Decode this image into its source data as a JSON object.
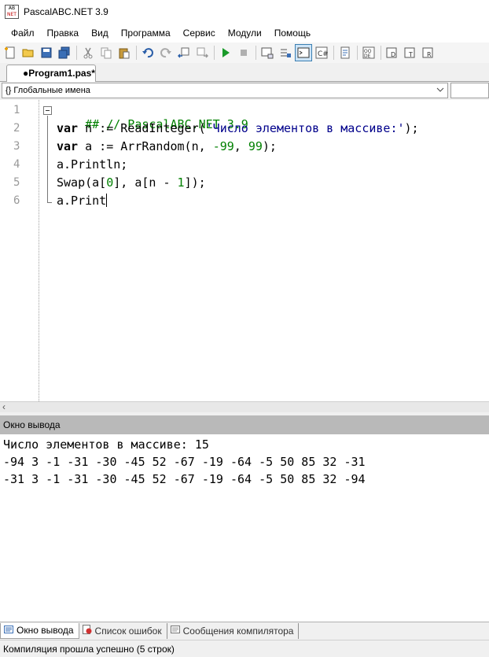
{
  "window": {
    "title": "PascalABC.NET 3.9",
    "icon": "pascalabc-app-icon"
  },
  "menu": [
    "Файл",
    "Правка",
    "Вид",
    "Программа",
    "Сервис",
    "Модули",
    "Помощь"
  ],
  "toolbar": {
    "icons": [
      "new-file-icon",
      "open-folder-icon",
      "save-icon",
      "save-all-icon",
      "cut-icon",
      "copy-icon",
      "paste-icon",
      "undo-icon",
      "redo-icon",
      "navigate-back-icon",
      "navigate-forward-icon",
      "run-icon",
      "stop-icon",
      "debug-console-icon",
      "debug-run-icon",
      "output-window-icon",
      "format-code-icon",
      "debug-step-icon",
      "code-snippet-icon",
      "designer-icon",
      "step-into-icon",
      "step-over-icon",
      "step-out-icon"
    ]
  },
  "tab": {
    "label": "●Program1.pas*"
  },
  "scope": {
    "label": "{} Глобальные имена"
  },
  "editor": {
    "line_numbers": [
      "1",
      "2",
      "3",
      "4",
      "5",
      "6"
    ],
    "lines": [
      [
        {
          "t": "## // PascalABC.NET 3.9",
          "c": "cm"
        }
      ],
      [
        {
          "t": "var",
          "c": "kw"
        },
        {
          "t": " n := ReadInteger(",
          "c": ""
        },
        {
          "t": "'Число элементов в массиве:'",
          "c": "str"
        },
        {
          "t": ");",
          "c": ""
        }
      ],
      [
        {
          "t": "var",
          "c": "kw"
        },
        {
          "t": " a := ArrRandom(n, ",
          "c": ""
        },
        {
          "t": "-99",
          "c": "num"
        },
        {
          "t": ", ",
          "c": ""
        },
        {
          "t": "99",
          "c": "num"
        },
        {
          "t": ");",
          "c": ""
        }
      ],
      [
        {
          "t": "a.Println;",
          "c": ""
        }
      ],
      [
        {
          "t": "Swap(a[",
          "c": ""
        },
        {
          "t": "0",
          "c": "num"
        },
        {
          "t": "], a[n - ",
          "c": ""
        },
        {
          "t": "1",
          "c": "num"
        },
        {
          "t": "]);",
          "c": ""
        }
      ],
      [
        {
          "t": "a.Print",
          "c": ""
        }
      ]
    ]
  },
  "output": {
    "header": "Окно вывода",
    "lines": [
      "Число элементов в массиве: 15",
      "-94 3 -1 -31 -30 -45 52 -67 -19 -64 -5 50 85 32 -31",
      "-31 3 -1 -31 -30 -45 52 -67 -19 -64 -5 50 85 32 -94"
    ]
  },
  "bottom_tabs": [
    {
      "label": "Окно вывода",
      "icon": "output-window-icon",
      "active": true
    },
    {
      "label": "Список ошибок",
      "icon": "error-list-icon",
      "active": false
    },
    {
      "label": "Сообщения компилятора",
      "icon": "compiler-messages-icon",
      "active": false
    }
  ],
  "status": "Компиляция прошла успешно (5 строк)"
}
